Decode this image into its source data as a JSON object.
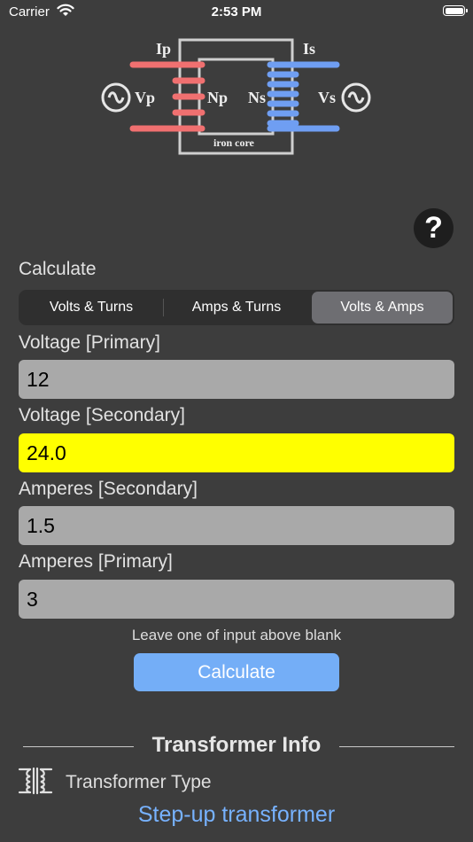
{
  "status_bar": {
    "carrier": "Carrier",
    "time": "2:53 PM",
    "battery_level": 1.0
  },
  "diagram": {
    "ip": "Ip",
    "is": "Is",
    "vp": "Vp",
    "np": "Np",
    "ns": "Ns",
    "vs": "Vs",
    "core": "iron core",
    "primary_color": "#f07070",
    "secondary_color": "#6f9ef2",
    "source_icons": [
      "ac-source-icon",
      "ac-source-icon"
    ]
  },
  "help": {
    "label": "?"
  },
  "calculate": {
    "label": "Calculate",
    "options": [
      "Volts & Turns",
      "Amps & Turns",
      "Volts & Amps"
    ],
    "selected": "Volts & Amps"
  },
  "fields": {
    "voltage_primary": {
      "label": "Voltage [Primary]",
      "value": "12"
    },
    "voltage_secondary": {
      "label": "Voltage [Secondary]",
      "value": "24.0",
      "highlight_color": "#ffff00"
    },
    "amperes_secondary": {
      "label": "Amperes [Secondary]",
      "value": "1.5"
    },
    "amperes_primary": {
      "label": "Amperes [Primary]",
      "value": "3"
    }
  },
  "hint": "Leave one of input above blank",
  "calculate_button": "Calculate",
  "info": {
    "title": "Transformer Info",
    "type_label": "Transformer Type",
    "type_icon": "transformer-icon",
    "type_value": "Step-up transformer",
    "accent": "#77b2ff"
  }
}
